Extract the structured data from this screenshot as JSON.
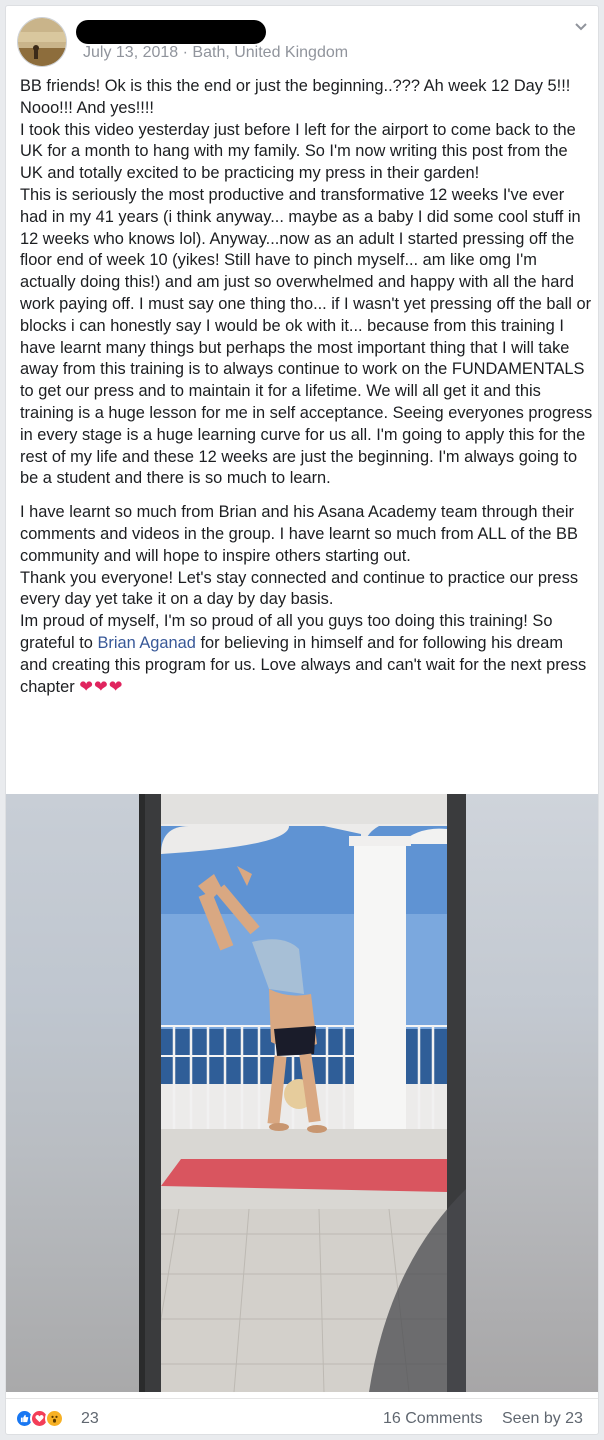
{
  "post": {
    "date": "July 13, 2018",
    "separator": "·",
    "location": "Bath, United Kingdom",
    "paragraphs_1": [
      "BB friends! Ok is this the end or just the beginning..??? Ah week 12 Day 5!!! Nooo!!! And yes!!!!",
      "I took this video yesterday just before I left for the airport to come back to the UK for a month to hang with my family. So I'm now writing this post from the UK and totally excited to be practicing my press in their garden!",
      "This is seriously the most productive and transformative 12 weeks I've ever had in my 41 years (i think anyway... maybe as a baby I did some cool stuff in 12 weeks who knows lol). Anyway...now as an adult I started pressing off the floor end of week 10 (yikes! Still have to pinch myself... am like omg I'm actually doing this!) and am just so overwhelmed and happy with all the hard work paying off. I must say one thing tho... if I wasn't yet pressing off the ball or blocks i can honestly say I would be ok with it... because from this training I have learnt many things but perhaps the most important thing that I will take away from this training is to always continue to work on the FUNDAMENTALS to get our press and to maintain it for a lifetime. We will all get it and this training is a huge lesson for me in self acceptance. Seeing everyones progress in every stage is a huge learning curve for us all. I'm going to apply this for the rest of my life and these 12 weeks are just the beginning. I'm always going to be a student and there is so much to learn."
    ],
    "paragraphs_2": [
      "I have learnt so much from Brian and his Asana Academy team through their comments and videos in the group. I have learnt so much from ALL of the BB community and will hope to inspire others starting out.",
      "Thank you everyone! Let's stay connected and continue to practice our press every day yet take it on a day by day basis."
    ],
    "last_before_mention": "Im proud of myself, I'm so proud of all you guys too doing this training! So grateful to ",
    "mention": "Brian Aganad",
    "last_after_mention": " for believing in himself and for following his dream and creating this program for us. Love always and can't wait for the next press chapter ",
    "hearts": "❤❤❤"
  },
  "footer": {
    "reactions_count": "23",
    "comments": "16 Comments",
    "seen_by": "Seen by 23"
  },
  "colors": {
    "link": "#385898",
    "like": "#1877f2",
    "love": "#f33e58",
    "wow": "#f7b125"
  },
  "icons": [
    "chevron-down-icon",
    "like-reaction-icon",
    "love-reaction-icon",
    "wow-reaction-icon"
  ]
}
